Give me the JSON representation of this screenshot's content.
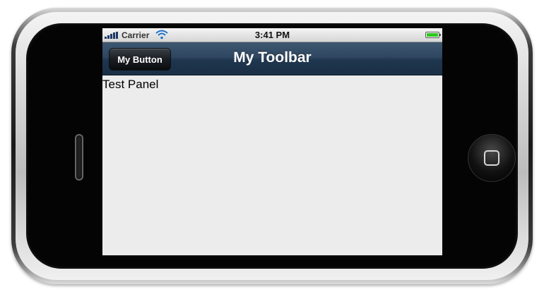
{
  "status_bar": {
    "carrier": "Carrier",
    "time": "3:41 PM",
    "battery_level": 1.0,
    "signal_bars": 5,
    "battery_color": "#2ec81f"
  },
  "toolbar": {
    "title": "My Toolbar",
    "button_label": "My Button",
    "background_color": "#2e4660"
  },
  "panel": {
    "text": "Test Panel"
  },
  "icons": {
    "signal": "signal-bars-icon",
    "wifi": "wifi-icon",
    "battery": "battery-icon",
    "home": "home-button-icon"
  }
}
